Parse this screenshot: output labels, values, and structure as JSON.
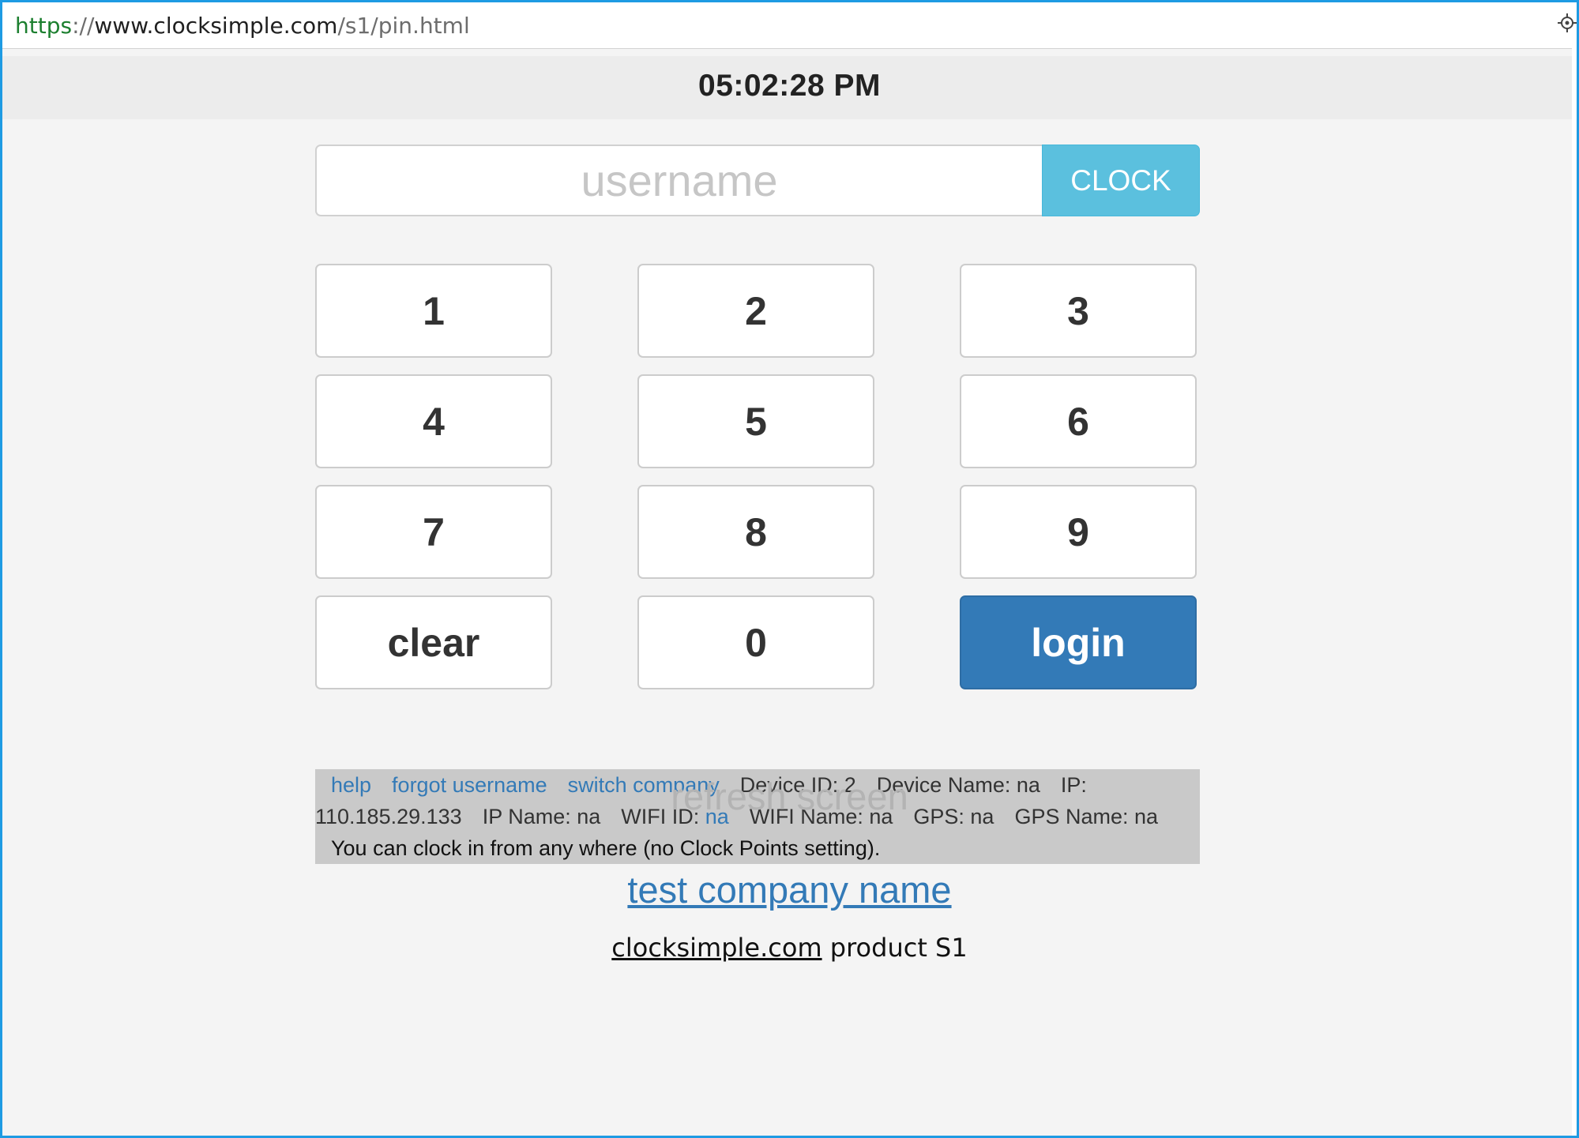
{
  "browser": {
    "url_scheme": "https",
    "url_separator": "://",
    "url_host": "www.clocksimple.com",
    "url_path": "/s1/pin.html",
    "right_icon": "target-icon"
  },
  "clock": {
    "time": "05:02:28 PM"
  },
  "login_form": {
    "username_placeholder": "username",
    "username_value": "",
    "clock_button_label": "CLOCK"
  },
  "keypad": {
    "keys": [
      "1",
      "2",
      "3",
      "4",
      "5",
      "6",
      "7",
      "8",
      "9",
      "clear",
      "0",
      "login"
    ]
  },
  "info": {
    "help_link": "help",
    "forgot_link": "forgot username",
    "switch_link": "switch company",
    "device_id": "Device ID: 2",
    "device_name": "Device Name: na",
    "ip_label": "IP:",
    "ip_value": "110.185.29.133",
    "ip_name": "IP Name: na",
    "wifi_id_label": "WIFI ID:",
    "wifi_id_value": "na",
    "wifi_name": "WIFI Name: na",
    "gps": "GPS: na",
    "gps_name": "GPS Name: na",
    "clock_points_note": "You can clock in from any where (no Clock Points setting)."
  },
  "footer": {
    "refresh_label": "refresh screen",
    "company_name": "test company name",
    "product_site": "clocksimple.com",
    "product_suffix": " product S1"
  },
  "colors": {
    "frame_border": "#1e9be3",
    "clock_button": "#5bc0de",
    "login_button": "#337ab7",
    "link": "#337ab7",
    "info_background": "#c9c9c9",
    "page_background": "#f4f4f4"
  }
}
